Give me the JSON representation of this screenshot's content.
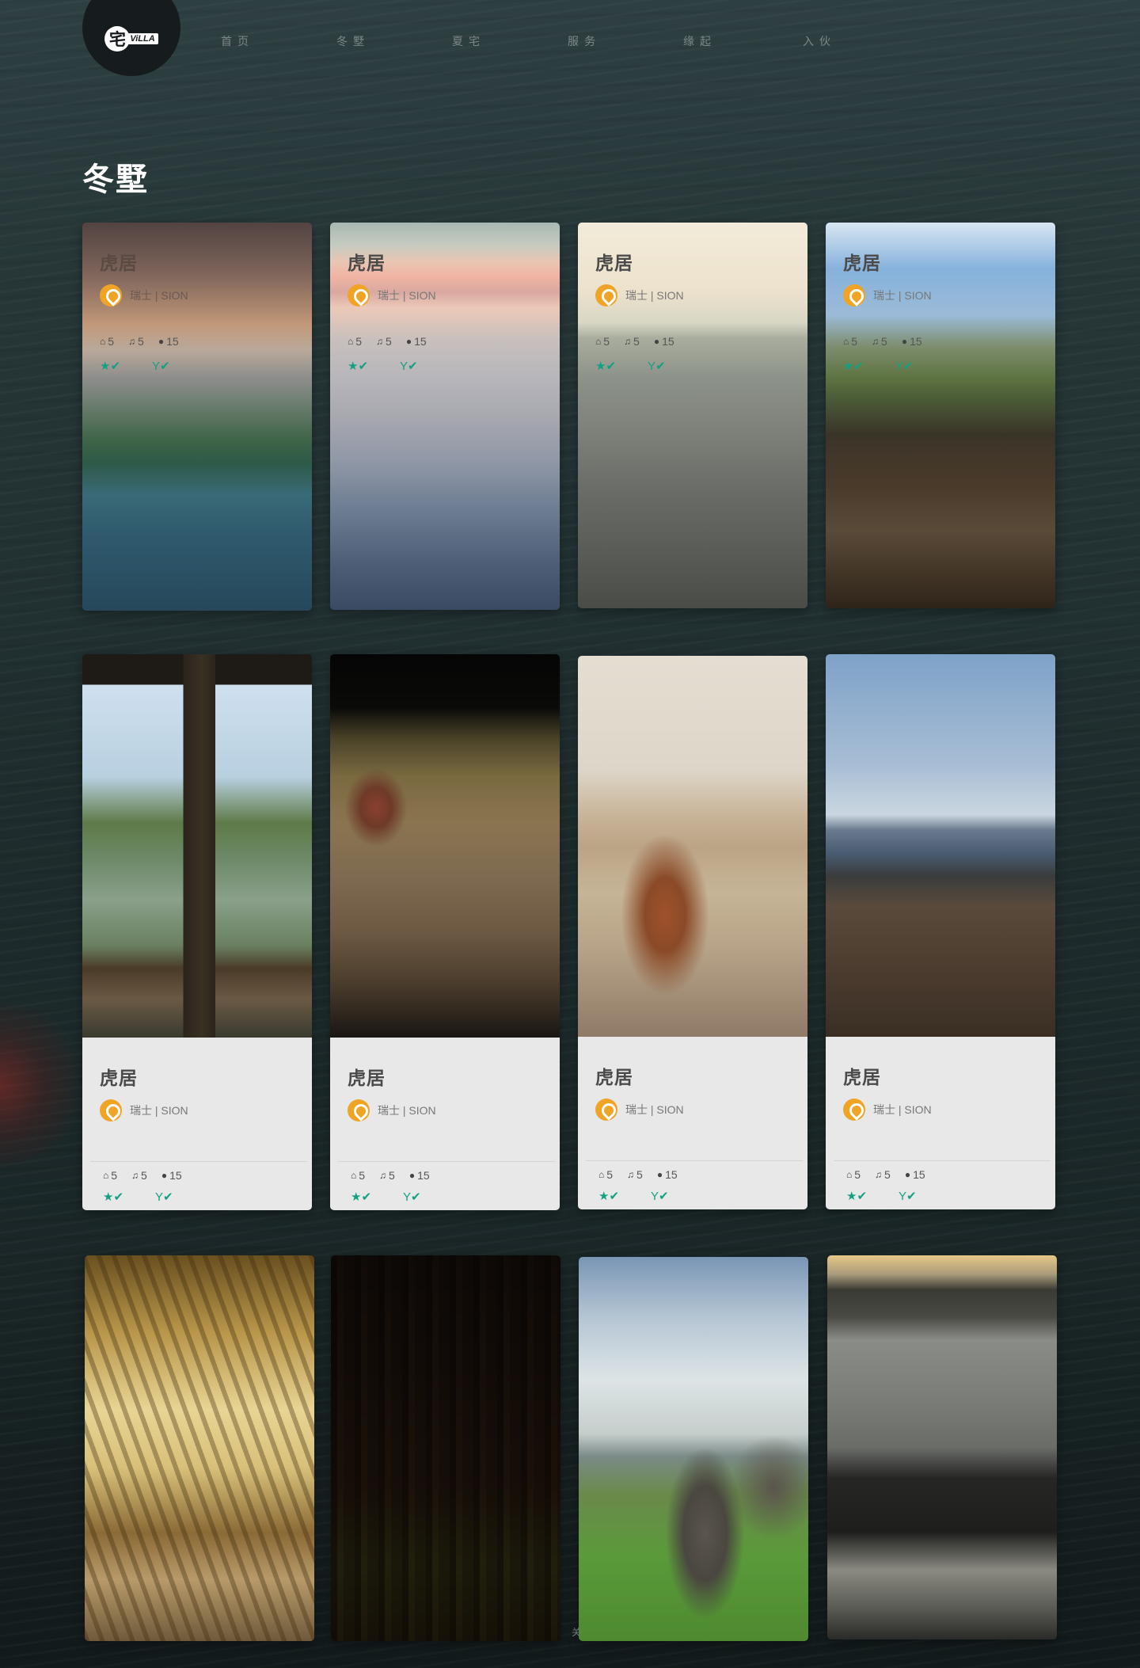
{
  "header": {
    "logo": {
      "mark": "宅",
      "text": "ViLLA"
    },
    "nav": [
      {
        "label": "首页"
      },
      {
        "label": "冬墅"
      },
      {
        "label": "夏宅"
      },
      {
        "label": "服务"
      },
      {
        "label": "缘起"
      },
      {
        "label": "入伙"
      }
    ]
  },
  "page": {
    "title": "冬墅"
  },
  "card_common": {
    "title": "虎居",
    "location": "瑞士 | SION",
    "rooms": "5",
    "music": "5",
    "people": "15",
    "amenity_star": "★✔",
    "amenity_cocktail": "Y✔"
  },
  "icons": {
    "home": "home-icon",
    "music": "music-icon",
    "user": "user-icon",
    "star": "star-icon",
    "cocktail": "cocktail-icon",
    "pin": "map-pin-icon"
  },
  "colors": {
    "accent_pin": "#f0a425",
    "amenity_green": "#13a082",
    "info_panel": "#e8e8e8"
  },
  "footer": {
    "mark": "关"
  }
}
